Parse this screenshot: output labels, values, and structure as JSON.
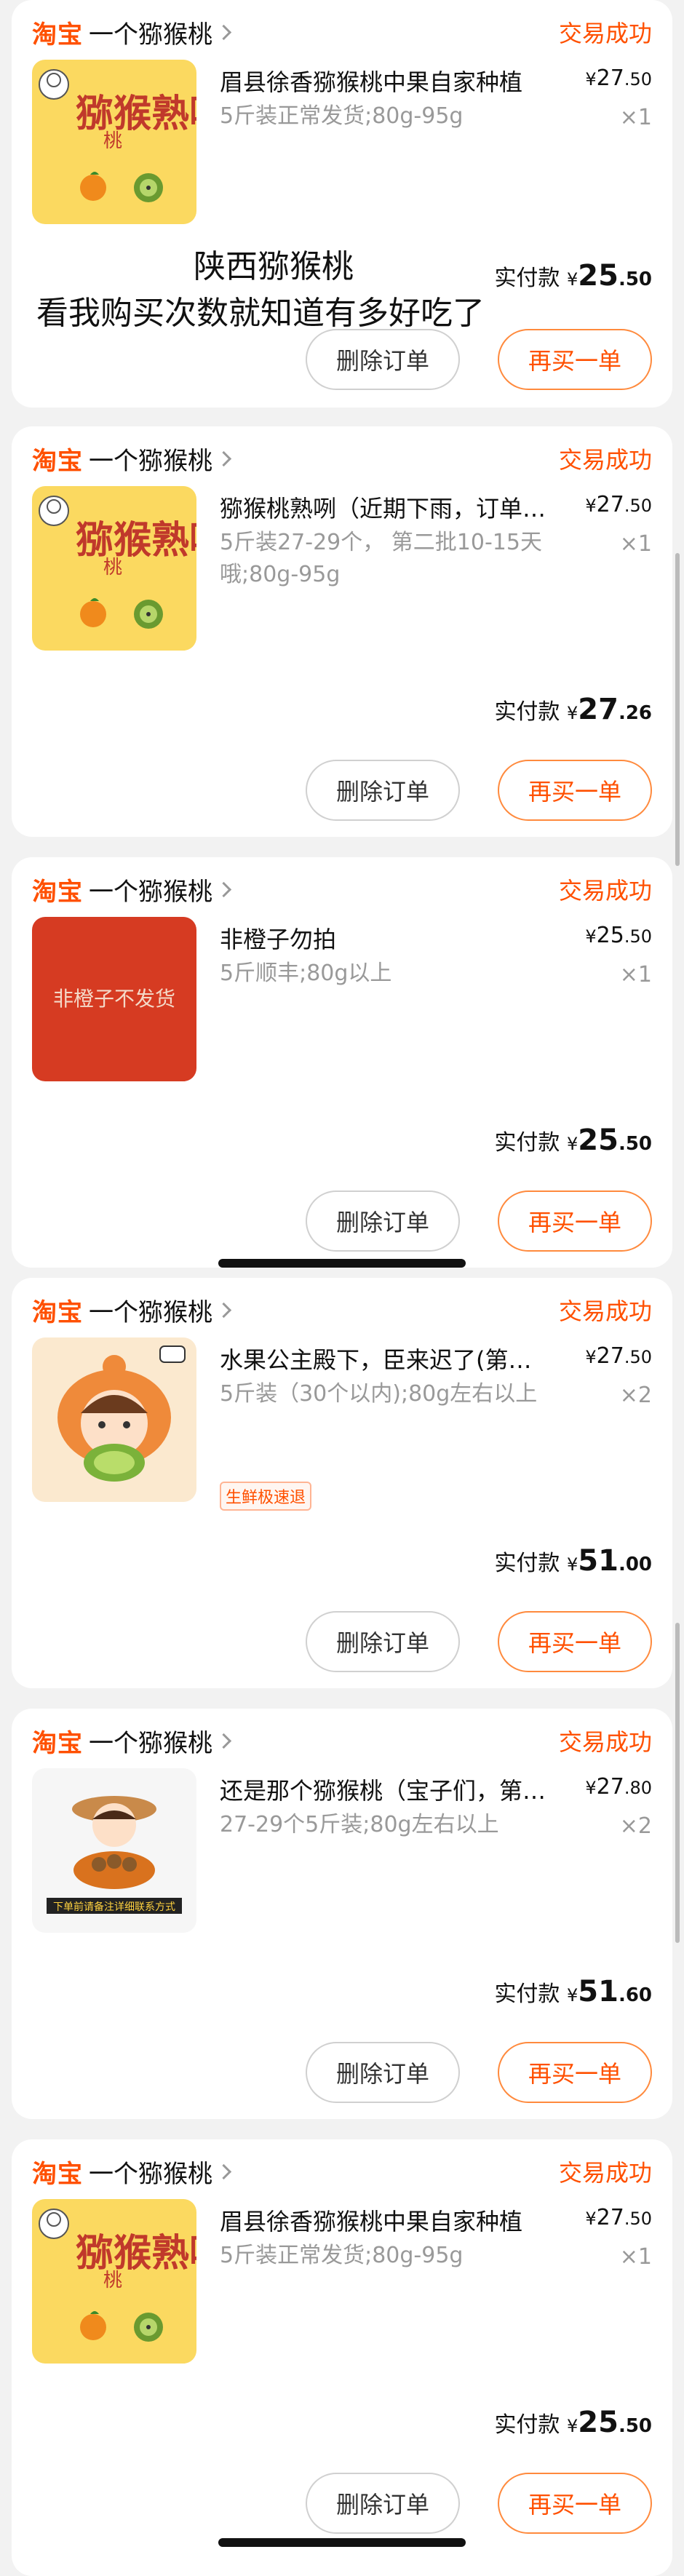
{
  "orders": [
    {
      "platform": "淘宝",
      "shop": "一个猕猴桃",
      "status": "交易成功",
      "title": "眉县徐香猕猴桃中果自家种植",
      "spec": "5斤装正常发货;80g-95g",
      "price_yen": "¥",
      "price_int": "27",
      "price_dec": ".50",
      "qty": "×1",
      "total_label": "实付款",
      "total_yen": "¥",
      "total_int": "25",
      "total_dec": ".50",
      "delete_label": "删除订单",
      "rebuy_label": "再买一单",
      "thumb_text": "猕猴熟咧",
      "thumb_small": "桃"
    },
    {
      "platform": "淘宝",
      "shop": "一个猕猴桃",
      "status": "交易成功",
      "title": "猕猴桃熟咧（近期下雨，订单…",
      "spec": "5斤装27-29个， 第二批10-15天哦;80g-95g",
      "price_yen": "¥",
      "price_int": "27",
      "price_dec": ".50",
      "qty": "×1",
      "total_label": "实付款",
      "total_yen": "¥",
      "total_int": "27",
      "total_dec": ".26",
      "delete_label": "删除订单",
      "rebuy_label": "再买一单",
      "thumb_text": "猕猴熟咧",
      "thumb_small": "桃"
    },
    {
      "platform": "淘宝",
      "shop": "一个猕猴桃",
      "status": "交易成功",
      "title": "非橙子勿拍",
      "spec": "5斤顺丰;80g以上",
      "price_yen": "¥",
      "price_int": "25",
      "price_dec": ".50",
      "qty": "×1",
      "total_label": "实付款",
      "total_yen": "¥",
      "total_int": "25",
      "total_dec": ".50",
      "delete_label": "删除订单",
      "rebuy_label": "再买一单",
      "thumb_text": "非橙子不发货"
    },
    {
      "platform": "淘宝",
      "shop": "一个猕猴桃",
      "status": "交易成功",
      "title": "水果公主殿下，臣来迟了(第…",
      "spec": "5斤装（30个以内);80g左右以上",
      "badge": "生鲜极速退",
      "price_yen": "¥",
      "price_int": "27",
      "price_dec": ".50",
      "qty": "×2",
      "total_label": "实付款",
      "total_yen": "¥",
      "total_int": "51",
      "total_dec": ".00",
      "delete_label": "删除订单",
      "rebuy_label": "再买一单"
    },
    {
      "platform": "淘宝",
      "shop": "一个猕猴桃",
      "status": "交易成功",
      "title": "还是那个猕猴桃（宝子们，第…",
      "spec": "27-29个5斤装;80g左右以上",
      "price_yen": "¥",
      "price_int": "27",
      "price_dec": ".80",
      "qty": "×2",
      "total_label": "实付款",
      "total_yen": "¥",
      "total_int": "51",
      "total_dec": ".60",
      "delete_label": "删除订单",
      "rebuy_label": "再买一单",
      "thumb_caption": "下单前请备注详细联系方式"
    },
    {
      "platform": "淘宝",
      "shop": "一个猕猴桃",
      "status": "交易成功",
      "title": "眉县徐香猕猴桃中果自家种植",
      "spec": "5斤装正常发货;80g-95g",
      "price_yen": "¥",
      "price_int": "27",
      "price_dec": ".50",
      "qty": "×1",
      "total_label": "实付款",
      "total_yen": "¥",
      "total_int": "25",
      "total_dec": ".50",
      "delete_label": "删除订单",
      "rebuy_label": "再买一单",
      "thumb_text": "猕猴熟咧",
      "thumb_small": "桃"
    }
  ],
  "overlay": {
    "line1": "陕西猕猴桃",
    "line2": "看我购买次数就知道有多好吃了"
  },
  "colors": {
    "accent": "#ff5000",
    "background": "#f2f2f2",
    "card": "#ffffff"
  }
}
